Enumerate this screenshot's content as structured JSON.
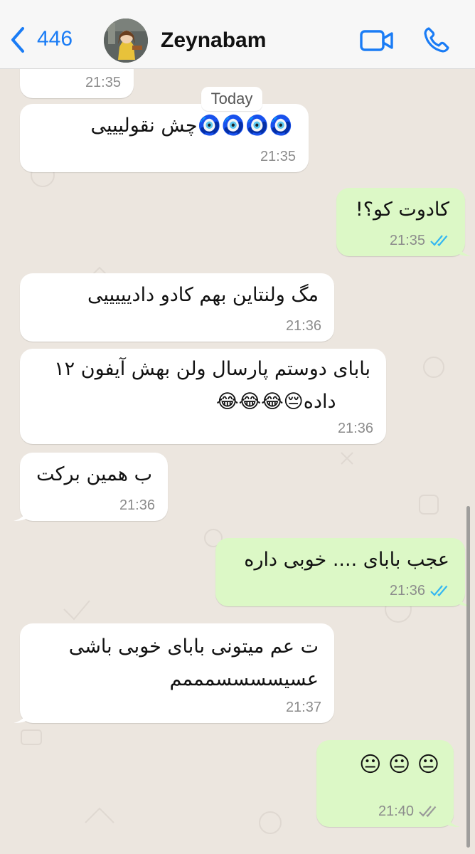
{
  "header": {
    "back_count": "446",
    "contact_name": "Zeynabam"
  },
  "date_chip": "Today",
  "messages": [
    {
      "dir": "in",
      "lines": [],
      "time": "21:35"
    },
    {
      "dir": "in",
      "lines": [
        "🧿🧿🧿🧿چش نقولیییی"
      ],
      "time": "21:35"
    },
    {
      "dir": "out",
      "lines": [
        "کادوت کو؟!"
      ],
      "time": "21:35",
      "ticks": "read"
    },
    {
      "dir": "in",
      "lines": [
        "مگ ولنتاین بهم کادو دادیییییی"
      ],
      "time": "21:36"
    },
    {
      "dir": "in",
      "lines": [
        "بابای دوستم پارسال ولن بهش آیفون ۱۲",
        "داده😔😂😂😂"
      ],
      "time": "21:36"
    },
    {
      "dir": "in",
      "lines": [
        "ب همین برکت"
      ],
      "time": "21:36"
    },
    {
      "dir": "out",
      "lines": [
        "عجب بابای .... خوبی داره"
      ],
      "time": "21:36",
      "ticks": "read"
    },
    {
      "dir": "in",
      "lines": [
        "ت عم میتونی بابای خوبی باشی",
        "عسیسسسسمممم"
      ],
      "time": "21:37"
    },
    {
      "dir": "out",
      "lines": [
        "😐 😐 😐"
      ],
      "time": "21:40",
      "ticks": "delivered"
    }
  ],
  "colors": {
    "accent": "#1a7cf5",
    "incoming_bubble": "#ffffff",
    "outgoing_bubble": "#dcf8c6",
    "read_ticks": "#34b7f1",
    "delivered_ticks": "#9a9a9a",
    "background": "#ece6df"
  },
  "icons": {
    "back": "chevron-left-icon",
    "video": "video-camera-icon",
    "call": "phone-icon"
  }
}
